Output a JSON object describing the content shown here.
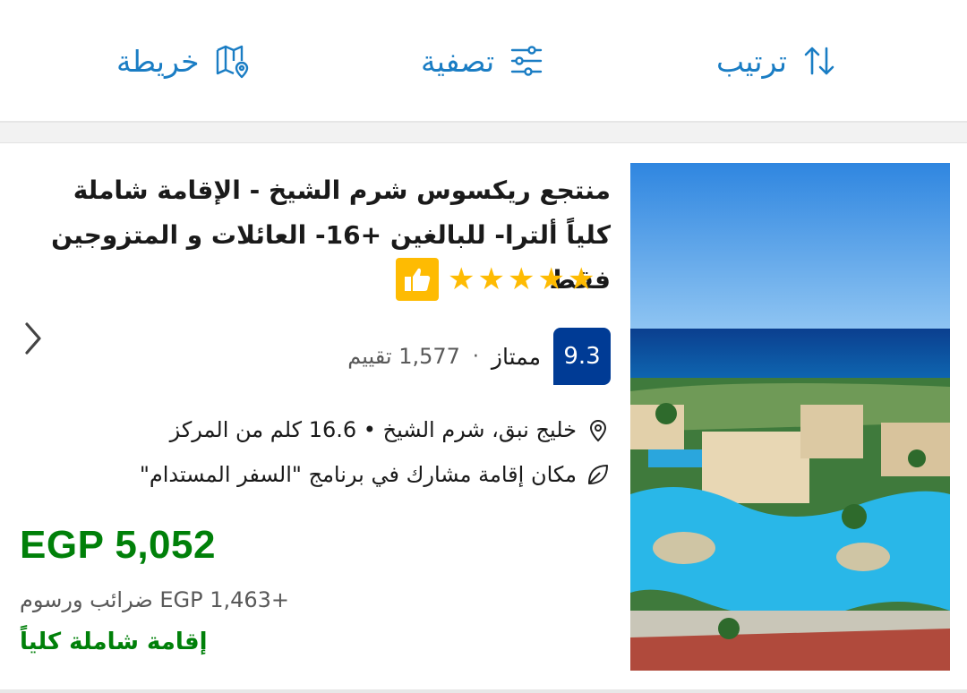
{
  "toolbar": {
    "sort_label": "ترتيب",
    "filter_label": "تصفية",
    "map_label": "خريطة"
  },
  "hotel": {
    "title": "منتجع ريكسوس شرم الشيخ - الإقامة شاملة كلياً ألترا- للبالغين +16- العائلات و المتزوجين فقط",
    "stars": 5,
    "score": "9.3",
    "rating_word": "ممتاز",
    "separator": "·",
    "reviews": "1,577 تقييم",
    "location": "خليج نبق، شرم الشيخ • 16.6 كلم من المركز",
    "sustainability": "مكان إقامة مشارك في برنامج \"السفر المستدام\"",
    "price": "EGP 5,052",
    "taxes": "+EGP 1,463 ضرائب ورسوم",
    "board": "إقامة شاملة كلياً"
  },
  "colors": {
    "accent_blue": "#1a7dc4",
    "score_bg": "#003b95",
    "price_green": "#008009",
    "star_yellow": "#febb02"
  },
  "icons": [
    "sort-icon",
    "filter-icon",
    "map-icon",
    "thumbs-up-icon",
    "star-icon",
    "location-pin-icon",
    "leaf-icon",
    "chevron-left-icon"
  ]
}
